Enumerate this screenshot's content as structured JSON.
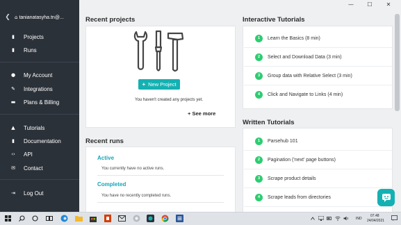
{
  "window": {
    "minimize_glyph": "—",
    "maximize_glyph": "☐",
    "close_glyph": "✕"
  },
  "sidebar": {
    "back_glyph": "❮",
    "home_glyph": "⌂",
    "username": "tanianatasyha.tn@...",
    "items": [
      {
        "label": "Projects",
        "icon": "file-icon",
        "glyph": "▮"
      },
      {
        "label": "Runs",
        "icon": "file-icon",
        "glyph": "▮"
      },
      {
        "label": "My Account",
        "icon": "user-icon",
        "glyph": "●"
      },
      {
        "label": "Integrations",
        "icon": "plug-icon",
        "glyph": "✎"
      },
      {
        "label": "Plans & Billing",
        "icon": "credit-card-icon",
        "glyph": "▬"
      },
      {
        "label": "Tutorials",
        "icon": "graduation-cap-icon",
        "glyph": "▲"
      },
      {
        "label": "Documentation",
        "icon": "book-icon",
        "glyph": "▮"
      },
      {
        "label": "API",
        "icon": "code-icon",
        "glyph": "‹›"
      },
      {
        "label": "Contact",
        "icon": "envelope-icon",
        "glyph": "✉"
      },
      {
        "label": "Log Out",
        "icon": "sign-out-icon",
        "glyph": "⇥"
      }
    ]
  },
  "projects": {
    "title": "Recent projects",
    "new_button": "New Project",
    "new_button_plus": "+",
    "empty_text": "You haven't created any projects yet.",
    "see_more_plus": "+",
    "see_more": "See more"
  },
  "runs": {
    "title": "Recent runs",
    "active_label": "Active",
    "active_text": "You currently have no active runs.",
    "completed_label": "Completed",
    "completed_text": "You have no recently completed runs."
  },
  "interactive_tutorials": {
    "title": "Interactive Tutorials",
    "items": [
      {
        "num": "1",
        "label": "Learn the Basics (8 min)"
      },
      {
        "num": "2",
        "label": "Select and Download Data (3 min)"
      },
      {
        "num": "3",
        "label": "Group data with Relative Select (3 min)"
      },
      {
        "num": "4",
        "label": "Click and Navigate to Links (4 min)"
      }
    ]
  },
  "written_tutorials": {
    "title": "Written Tutorials",
    "items": [
      {
        "num": "1",
        "label": "Parsehub 101"
      },
      {
        "num": "2",
        "label": "Pagination ('next' page buttons)"
      },
      {
        "num": "3",
        "label": "Scrape product details"
      },
      {
        "num": "4",
        "label": "Scrape leads from directories"
      }
    ]
  },
  "colors": {
    "sidebar_bg": "#2b3139",
    "accent_teal": "#14b1b3",
    "tutorial_green": "#2ecc71"
  },
  "taskbar": {
    "time": "07.48",
    "date": "24/04/2021",
    "language": "IND"
  }
}
